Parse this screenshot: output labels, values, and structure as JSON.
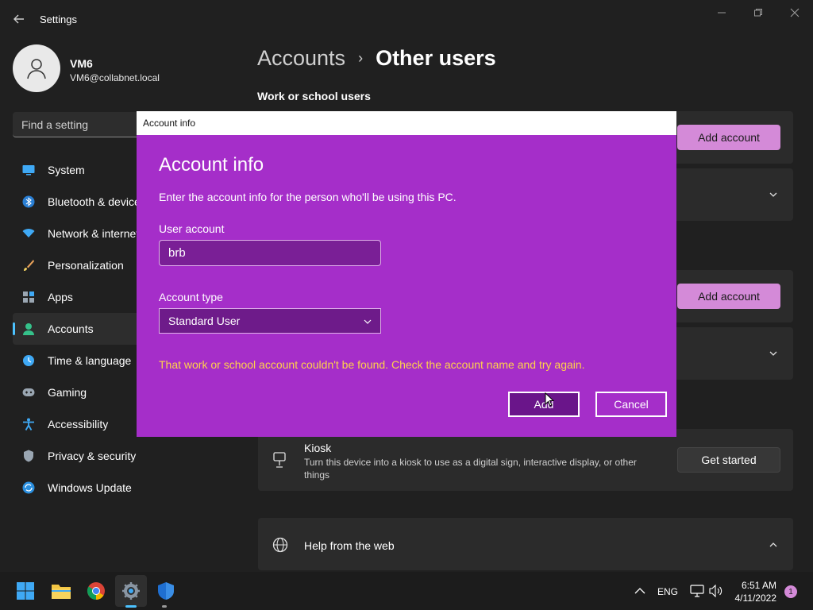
{
  "app": {
    "title": "Settings"
  },
  "profile": {
    "name": "VM6",
    "email": "VM6@collabnet.local"
  },
  "search": {
    "placeholder": "Find a setting"
  },
  "nav": {
    "items": [
      {
        "label": "System",
        "icon": "monitor-icon"
      },
      {
        "label": "Bluetooth & devices",
        "icon": "bluetooth-icon"
      },
      {
        "label": "Network & internet",
        "icon": "wifi-icon"
      },
      {
        "label": "Personalization",
        "icon": "brush-icon"
      },
      {
        "label": "Apps",
        "icon": "apps-icon"
      },
      {
        "label": "Accounts",
        "icon": "person-icon",
        "selected": true
      },
      {
        "label": "Time & language",
        "icon": "clock-globe-icon"
      },
      {
        "label": "Gaming",
        "icon": "gamepad-icon"
      },
      {
        "label": "Accessibility",
        "icon": "accessibility-icon"
      },
      {
        "label": "Privacy & security",
        "icon": "shield-icon"
      },
      {
        "label": "Windows Update",
        "icon": "update-icon"
      }
    ]
  },
  "main": {
    "breadcrumb": {
      "parent": "Accounts",
      "separator": "›",
      "current": "Other users"
    },
    "section_title": "Work or school users",
    "add_account_label": "Add account",
    "kiosk": {
      "title": "Kiosk",
      "description": "Turn this device into a kiosk to use as a digital sign, interactive display, or other things",
      "button": "Get started"
    },
    "help": {
      "title": "Help from the web"
    }
  },
  "dialog": {
    "window_title": "Account info",
    "heading": "Account info",
    "text": "Enter the account info for the person who'll be using this PC.",
    "user_label": "User account",
    "user_value": "brb",
    "type_label": "Account type",
    "type_value": "Standard User",
    "error": "That work or school account couldn't be found. Check the account name and try again.",
    "add": "Add",
    "cancel": "Cancel"
  },
  "taskbar": {
    "lang": "ENG",
    "time": "6:51 AM",
    "date": "4/11/2022",
    "notification_count": "1"
  },
  "colors": {
    "accent": "#d48ad8",
    "dialog_bg": "#a52ec9",
    "error_text": "#ffd24a",
    "selection_bar": "#4cc2ff"
  }
}
